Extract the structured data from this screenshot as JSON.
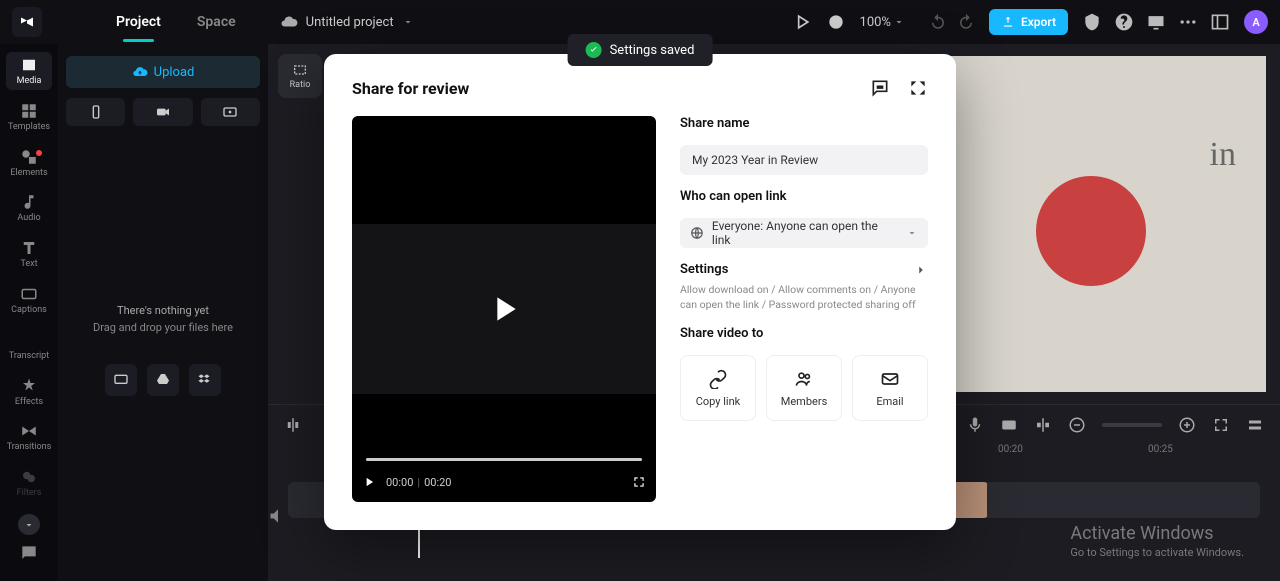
{
  "topbar": {
    "tabs": {
      "project": "Project",
      "space": "Space"
    },
    "project_name": "Untitled project",
    "zoom": "100%",
    "export_label": "Export",
    "avatar_initial": "A"
  },
  "toast": {
    "message": "Settings saved"
  },
  "rail": {
    "media": "Media",
    "templates": "Templates",
    "elements": "Elements",
    "audio": "Audio",
    "text": "Text",
    "captions": "Captions",
    "transcript": "Transcript",
    "effects": "Effects",
    "transitions": "Transitions",
    "filters": "Filters"
  },
  "media_panel": {
    "upload_label": "Upload",
    "empty_l1": "There's nothing yet",
    "empty_l2": "Drag and drop your files here"
  },
  "canvas": {
    "ratio_label": "Ratio"
  },
  "timeline": {
    "ruler": [
      "00:20",
      "00:25"
    ]
  },
  "activate": {
    "title": "Activate Windows",
    "sub": "Go to Settings to activate Windows."
  },
  "modal": {
    "title": "Share for review",
    "share_name_label": "Share name",
    "share_name_value": "My 2023 Year in Review",
    "who_label": "Who can open link",
    "who_value": "Everyone: Anyone can open the link",
    "settings_label": "Settings",
    "settings_desc": "Allow download on / Allow comments on / Anyone can open the link / Password protected sharing off",
    "share_to_label": "Share video to",
    "targets": {
      "copy": "Copy link",
      "members": "Members",
      "email": "Email"
    },
    "player": {
      "current": "00:00",
      "sep": "|",
      "total": "00:20"
    }
  }
}
